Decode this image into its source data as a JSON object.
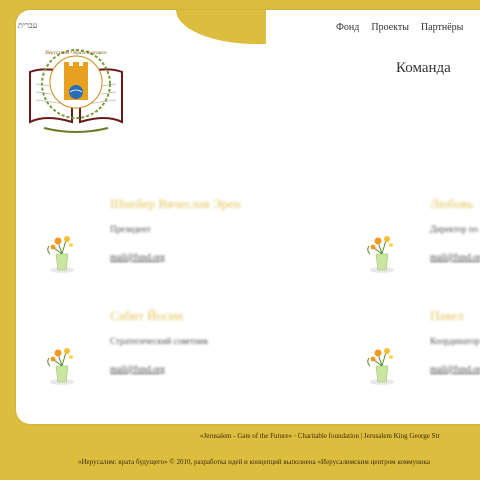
{
  "header": {
    "lang_link": "עברית",
    "nav": [
      "Фонд",
      "Проекты",
      "Партнёры"
    ],
    "page_title": "Команда"
  },
  "logo": {
    "ring_text": "Иерусалим • Врата будущего"
  },
  "members": [
    {
      "name": "Шнейер Вячеслав Эрен",
      "role": "Президент",
      "email": "mail@fund.org"
    },
    {
      "name": "Любовь",
      "role": "Директор по",
      "email": "mail@fund.org"
    },
    {
      "name": "Сабит Йосин",
      "role": "Стратегический советник",
      "email": "mail@fund.org"
    },
    {
      "name": "Павел",
      "role": "Координатор",
      "email": "mail@fund.org"
    }
  ],
  "footer": {
    "line1": "«Jerusalem - Gate of the Future» · Charitable foundation | Jerusalem King George Str",
    "line2": "«Иерусалим: врата будущего» © 2010, разработка идей и концепций выполнена «Иерусалимским центром коммуника"
  },
  "colors": {
    "background": "#ddbd3e",
    "card": "#ffffff",
    "name_gold": "#e2c55a"
  }
}
